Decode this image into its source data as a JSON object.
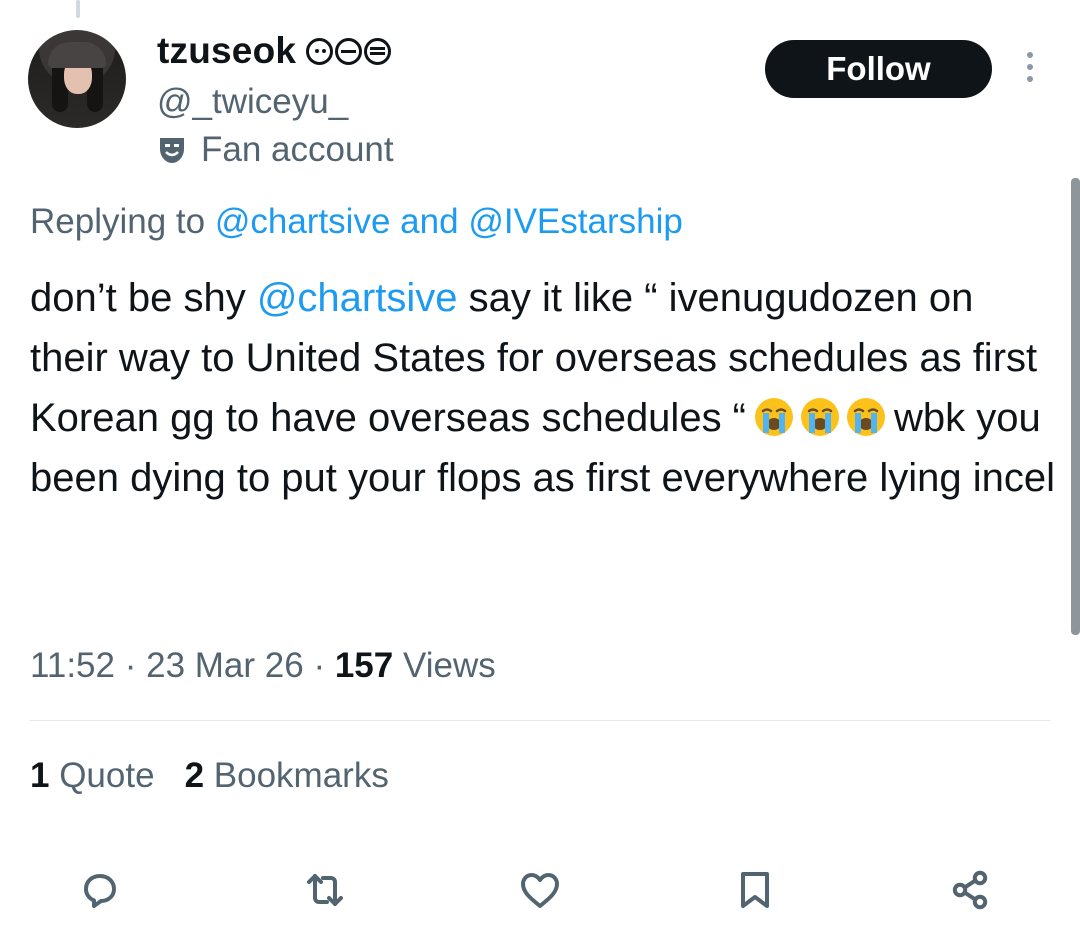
{
  "author": {
    "display_name": "tzuseok",
    "name_icons": [
      "face-icon",
      "minus-circle-icon",
      "equals-circle-icon"
    ],
    "handle": "@_twiceyu_",
    "account_label": "Fan account",
    "account_label_icon": "theater-mask-icon"
  },
  "follow_button_label": "Follow",
  "reply_context": {
    "prefix": "Replying to",
    "user1": "@chartsive",
    "joiner": "and",
    "user2": "@IVEstarship"
  },
  "tweet": {
    "part1": "don’t be shy ",
    "mention": "@chartsive",
    "part2": " say it like “ ivenugudozen on their way to United States for overseas schedules as first Korean gg to have overseas schedules “",
    "emojis": [
      "loudly-crying-face",
      "loudly-crying-face",
      "loudly-crying-face"
    ],
    "part3": "wbk you been dying to put your flops as first everywhere lying incel"
  },
  "meta": {
    "time": "11:52",
    "sep": "·",
    "date": "23 Mar 26",
    "views_count": "157",
    "views_label": "Views"
  },
  "stats": {
    "quotes_count": "1",
    "quotes_label": "Quote",
    "bookmarks_count": "2",
    "bookmarks_label": "Bookmarks"
  },
  "actions": [
    "reply-icon",
    "retweet-icon",
    "like-icon",
    "bookmark-icon",
    "share-icon"
  ],
  "colors": {
    "link": "#1d9bf0",
    "secondary_text": "#536471",
    "primary_text": "#0f1419",
    "button_bg": "#0f1419"
  }
}
